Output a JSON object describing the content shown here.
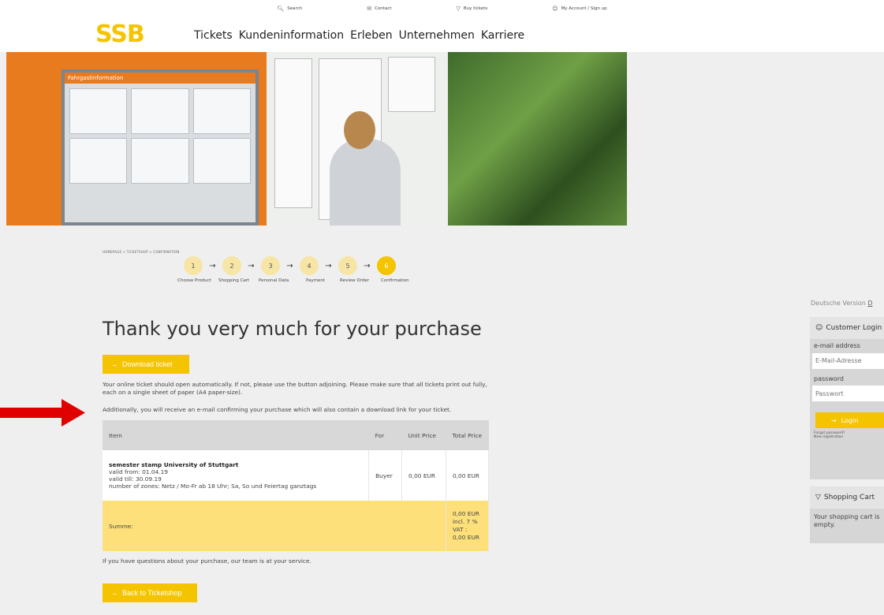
{
  "utility": {
    "search": "Search",
    "contact": "Contact",
    "buy_tickets": "Buy tickets",
    "account": "My Account / Sign up"
  },
  "header": {
    "logo": "SSB",
    "nav": [
      "Tickets",
      "Kundeninformation",
      "Erleben",
      "Unternehmen",
      "Karriere"
    ]
  },
  "hero": {
    "board_title": "Fahrgastinformation"
  },
  "breadcrumb": {
    "items": [
      "HOMEPAGE",
      "TICKETSHOP",
      "CONFIRMATION"
    ]
  },
  "steps": [
    {
      "num": "1",
      "label": "Choose Product"
    },
    {
      "num": "2",
      "label": "Shopping Cart"
    },
    {
      "num": "3",
      "label": "Personal Data"
    },
    {
      "num": "4",
      "label": "Payment"
    },
    {
      "num": "5",
      "label": "Review Order"
    },
    {
      "num": "6",
      "label": "Confirmation"
    }
  ],
  "main": {
    "title": "Thank you very much for your purchase",
    "download_button": "Download ticket",
    "para1": "Your online ticket should open automatically. If not, please use the button adjoining. Please make sure that all tickets print out fully, each on a single sheet of paper (A4 paper-size).",
    "para2": "Additionally, you will receive an e-mail confirming your purchase which will also contain a download link for your ticket.",
    "questions": "If you have questions about your purchase, our team is at your service.",
    "back_button": "Back to Ticketshop"
  },
  "table": {
    "headers": {
      "item": "Item",
      "for": "For",
      "unit_price": "Unit Price",
      "total_price": "Total Price"
    },
    "row": {
      "name": "semester stamp University of Stuttgart",
      "valid_from": "valid from: 01.04.19",
      "valid_till": "valid till: 30.09.19",
      "zones": "number of zones: Netz / Mo-Fr ab 18 Uhr; Sa, So und Feiertag ganztags",
      "for": "Buyer",
      "unit_price": "0,00 EUR",
      "total_price": "0,00 EUR"
    },
    "sum": {
      "label": "Summe:",
      "total": "0,00 EUR",
      "vat_label": "incl. 7 % VAT :",
      "vat": "0,00 EUR"
    }
  },
  "sidebar": {
    "language": "Deutsche Version",
    "language_tail": "D",
    "login": {
      "title": "Customer Login",
      "email_label": "e-mail address",
      "email_placeholder": "E-Mail-Adresse",
      "password_label": "password",
      "password_placeholder": "Passwort",
      "button": "Login",
      "forgot": "Forgot password?",
      "register": "New registration"
    },
    "cart": {
      "title": "Shopping Cart",
      "message": "Your shopping cart is empty."
    }
  },
  "colors": {
    "accent": "#f5c400",
    "step_inactive": "#f7e5a6",
    "sum_row": "#fde07a",
    "annotation_arrow": "#e00000"
  }
}
